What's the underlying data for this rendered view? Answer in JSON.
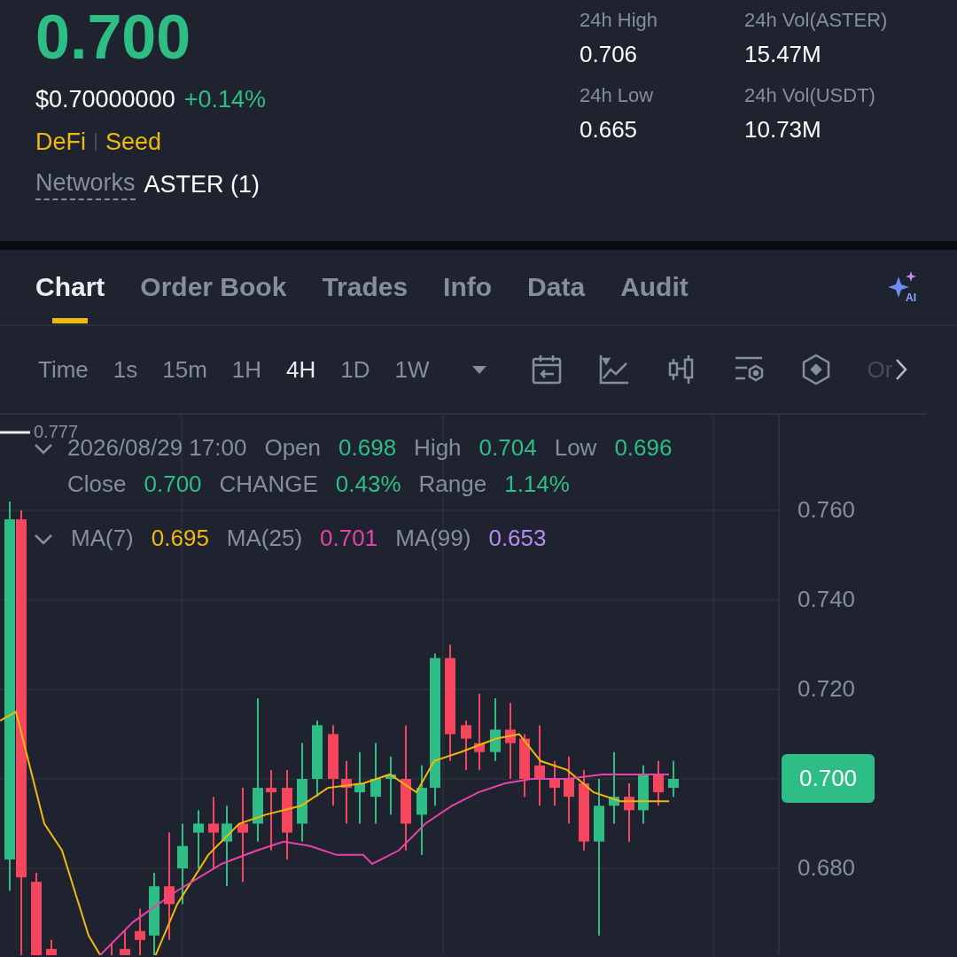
{
  "ticker": {
    "price": "0.700",
    "usd_price": "$0.70000000",
    "change": "+0.14%",
    "tags": [
      "DeFi",
      "Seed"
    ],
    "networks_label": "Networks",
    "networks_value": "ASTER (1)"
  },
  "stats": [
    {
      "label": "24h High",
      "value": "0.706"
    },
    {
      "label": "24h Vol(ASTER)",
      "value": "15.47M"
    },
    {
      "label": "24h Low",
      "value": "0.665"
    },
    {
      "label": "24h Vol(USDT)",
      "value": "10.73M"
    }
  ],
  "tabs": [
    {
      "label": "Chart",
      "selected": true
    },
    {
      "label": "Order Book",
      "selected": false
    },
    {
      "label": "Trades",
      "selected": false
    },
    {
      "label": "Info",
      "selected": false
    },
    {
      "label": "Data",
      "selected": false
    },
    {
      "label": "Audit",
      "selected": false
    }
  ],
  "intervals": [
    {
      "label": "Time",
      "selected": false
    },
    {
      "label": "1s",
      "selected": false
    },
    {
      "label": "15m",
      "selected": false
    },
    {
      "label": "1H",
      "selected": false
    },
    {
      "label": "4H",
      "selected": true
    },
    {
      "label": "1D",
      "selected": false
    },
    {
      "label": "1W",
      "selected": false
    }
  ],
  "toolbar_more": "Or",
  "ai_badge": "AI",
  "chart": {
    "high_marker": "0.777",
    "ohlc": [
      {
        "text": "2026/08/29 17:00",
        "kind": "label"
      },
      {
        "text": "Open",
        "kind": "label"
      },
      {
        "text": "0.698",
        "kind": "value"
      },
      {
        "text": "High",
        "kind": "label"
      },
      {
        "text": "0.704",
        "kind": "value"
      },
      {
        "text": "Low",
        "kind": "label"
      },
      {
        "text": "0.696",
        "kind": "value"
      },
      {
        "text": "Close",
        "kind": "label"
      },
      {
        "text": "0.700",
        "kind": "value"
      },
      {
        "text": "CHANGE",
        "kind": "label"
      },
      {
        "text": "0.43%",
        "kind": "value"
      },
      {
        "text": "Range",
        "kind": "label"
      },
      {
        "text": "1.14%",
        "kind": "value"
      }
    ],
    "moving_averages": [
      {
        "label": "MA(7)",
        "value": "0.695",
        "color": "#f0b90b"
      },
      {
        "label": "MA(25)",
        "value": "0.701",
        "color": "#e843a8"
      },
      {
        "label": "MA(99)",
        "value": "0.653",
        "color": "#b48cf2"
      }
    ],
    "axis_labels": [
      {
        "label": "0.760",
        "kind": "tick"
      },
      {
        "label": "0.740",
        "kind": "tick"
      },
      {
        "label": "0.720",
        "kind": "tick"
      },
      {
        "label": "0.700",
        "kind": "current"
      },
      {
        "label": "0.680",
        "kind": "tick"
      }
    ]
  }
}
